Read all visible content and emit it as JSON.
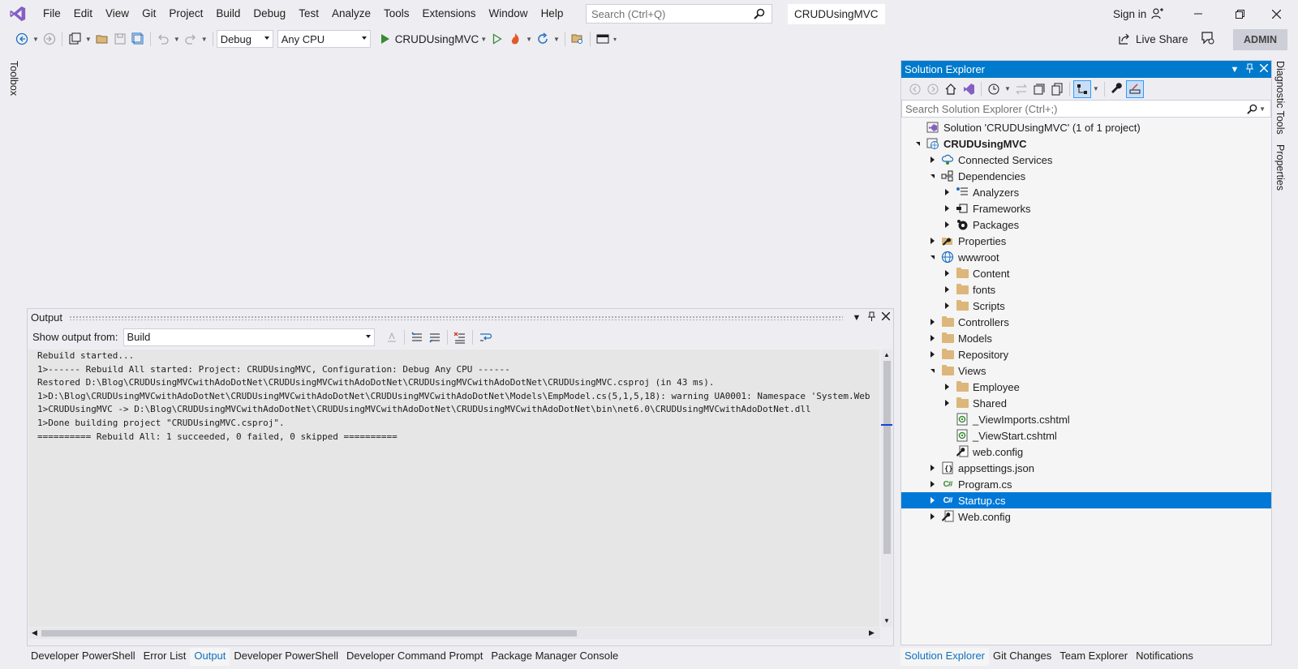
{
  "menu": [
    "File",
    "Edit",
    "View",
    "Git",
    "Project",
    "Build",
    "Debug",
    "Test",
    "Analyze",
    "Tools",
    "Extensions",
    "Window",
    "Help"
  ],
  "search": {
    "placeholder": "Search (Ctrl+Q)"
  },
  "solution_name": "CRUDUsingMVC",
  "sign_in": "Sign in",
  "toolbar": {
    "configuration": "Debug",
    "platform": "Any CPU",
    "run_target": "CRUDUsingMVC",
    "live_share": "Live Share",
    "admin": "ADMIN"
  },
  "side_tabs": {
    "toolbox": "Toolbox",
    "diagnostic": "Diagnostic Tools",
    "properties": "Properties"
  },
  "output": {
    "title": "Output",
    "show_from_label": "Show output from:",
    "source": "Build",
    "lines": [
      "Rebuild started...",
      "1>------ Rebuild All started: Project: CRUDUsingMVC, Configuration: Debug Any CPU ------",
      "Restored D:\\Blog\\CRUDUsingMVCwithAdoDotNet\\CRUDUsingMVCwithAdoDotNet\\CRUDUsingMVCwithAdoDotNet\\CRUDUsingMVC.csproj (in 43 ms).",
      "1>D:\\Blog\\CRUDUsingMVCwithAdoDotNet\\CRUDUsingMVCwithAdoDotNet\\CRUDUsingMVCwithAdoDotNet\\Models\\EmpModel.cs(5,1,5,18): warning UA0001: Namespace 'System.Web",
      "1>CRUDUsingMVC -> D:\\Blog\\CRUDUsingMVCwithAdoDotNet\\CRUDUsingMVCwithAdoDotNet\\CRUDUsingMVCwithAdoDotNet\\bin\\net6.0\\CRUDUsingMVCwithAdoDotNet.dll",
      "1>Done building project \"CRUDUsingMVC.csproj\".",
      "========== Rebuild All: 1 succeeded, 0 failed, 0 skipped =========="
    ]
  },
  "bottom_tabs": [
    "Developer PowerShell",
    "Error List",
    "Output",
    "Developer PowerShell",
    "Developer Command Prompt",
    "Package Manager Console"
  ],
  "solution_explorer": {
    "title": "Solution Explorer",
    "search_placeholder": "Search Solution Explorer (Ctrl+;)",
    "items": [
      {
        "label": "Solution 'CRUDUsingMVC' (1 of 1 project)",
        "level": 0,
        "exp": "none",
        "icon": "solution-icon"
      },
      {
        "label": "CRUDUsingMVC",
        "level": 0,
        "exp": "expanded",
        "icon": "web-project-icon",
        "bold": true
      },
      {
        "label": "Connected Services",
        "level": 1,
        "exp": "collapsed",
        "icon": "connected-services-icon"
      },
      {
        "label": "Dependencies",
        "level": 1,
        "exp": "expanded",
        "icon": "dependencies-icon"
      },
      {
        "label": "Analyzers",
        "level": 2,
        "exp": "collapsed",
        "icon": "analyzers-icon"
      },
      {
        "label": "Frameworks",
        "level": 2,
        "exp": "collapsed",
        "icon": "frameworks-icon"
      },
      {
        "label": "Packages",
        "level": 2,
        "exp": "collapsed",
        "icon": "packages-icon"
      },
      {
        "label": "Properties",
        "level": 1,
        "exp": "collapsed",
        "icon": "properties-folder-icon"
      },
      {
        "label": "wwwroot",
        "level": 1,
        "exp": "expanded",
        "icon": "globe-icon"
      },
      {
        "label": "Content",
        "level": 2,
        "exp": "collapsed",
        "icon": "folder-icon"
      },
      {
        "label": "fonts",
        "level": 2,
        "exp": "collapsed",
        "icon": "folder-icon"
      },
      {
        "label": "Scripts",
        "level": 2,
        "exp": "collapsed",
        "icon": "folder-icon"
      },
      {
        "label": "Controllers",
        "level": 1,
        "exp": "collapsed",
        "icon": "folder-icon"
      },
      {
        "label": "Models",
        "level": 1,
        "exp": "collapsed",
        "icon": "folder-icon"
      },
      {
        "label": "Repository",
        "level": 1,
        "exp": "collapsed",
        "icon": "folder-icon"
      },
      {
        "label": "Views",
        "level": 1,
        "exp": "expanded",
        "icon": "folder-icon"
      },
      {
        "label": "Employee",
        "level": 2,
        "exp": "collapsed",
        "icon": "folder-icon"
      },
      {
        "label": "Shared",
        "level": 2,
        "exp": "collapsed",
        "icon": "folder-icon"
      },
      {
        "label": "_ViewImports.cshtml",
        "level": 2,
        "exp": "none",
        "icon": "razor-file-icon"
      },
      {
        "label": "_ViewStart.cshtml",
        "level": 2,
        "exp": "none",
        "icon": "razor-file-icon"
      },
      {
        "label": "web.config",
        "level": 2,
        "exp": "none",
        "icon": "config-file-icon"
      },
      {
        "label": "appsettings.json",
        "level": 1,
        "exp": "collapsed",
        "icon": "json-file-icon"
      },
      {
        "label": "Program.cs",
        "level": 1,
        "exp": "collapsed",
        "icon": "csharp-file-icon"
      },
      {
        "label": "Startup.cs",
        "level": 1,
        "exp": "collapsed",
        "icon": "csharp-file-icon",
        "selected": true
      },
      {
        "label": "Web.config",
        "level": 1,
        "exp": "collapsed",
        "icon": "config-file-icon"
      }
    ],
    "bottom_tabs": [
      "Solution Explorer",
      "Git Changes",
      "Team Explorer",
      "Notifications"
    ]
  },
  "colors": {
    "accent": "#007acc",
    "selection": "#0078d7",
    "logo": "#865fc5",
    "run": "#388a34"
  }
}
